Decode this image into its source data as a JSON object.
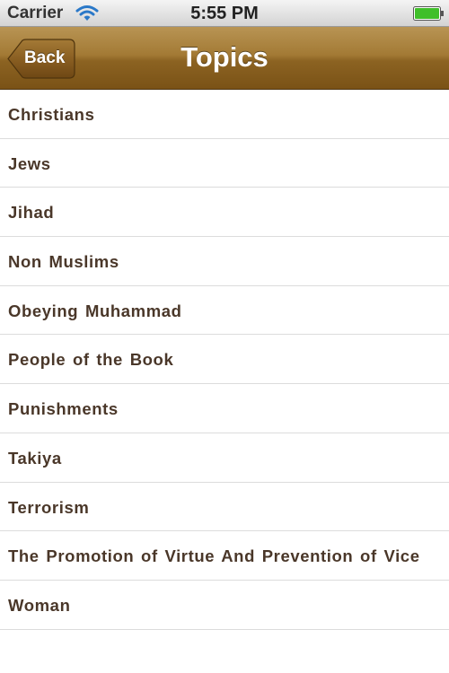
{
  "status_bar": {
    "carrier": "Carrier",
    "time": "5:55 PM"
  },
  "nav": {
    "back_label": "Back",
    "title": "Topics",
    "tint_color": "#9c7430"
  },
  "topics": [
    "Christians",
    "Jews",
    "Jihad",
    "Non Muslims",
    "Obeying Muhammad",
    "People of the Book",
    "Punishments",
    "Takiya",
    "Terrorism",
    "The Promotion of Virtue And Prevention of Vice",
    "Woman"
  ]
}
